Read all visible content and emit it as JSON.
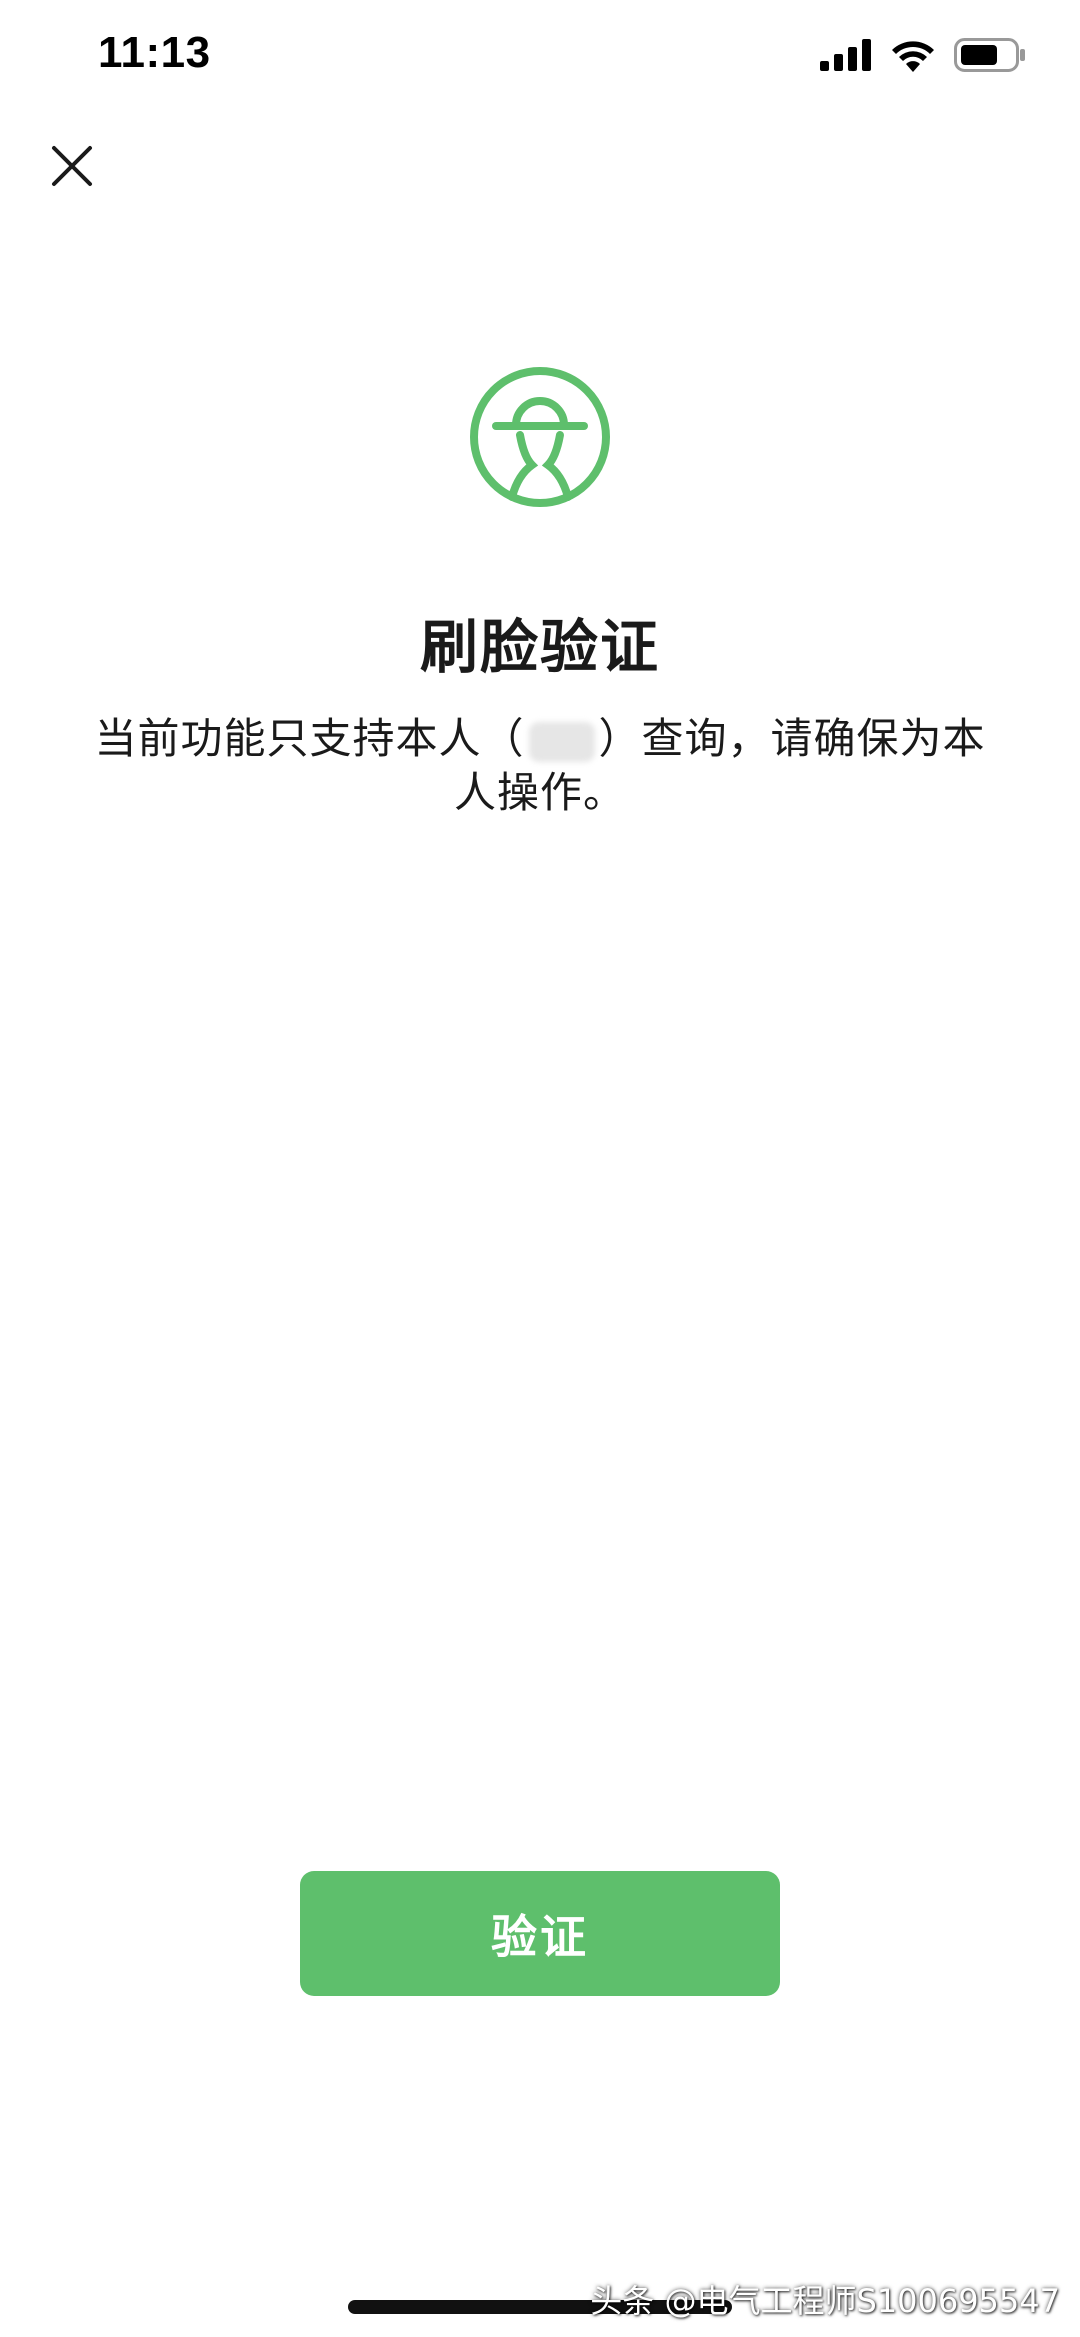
{
  "status_bar": {
    "time": "11:13",
    "icons": [
      "signal-icon",
      "wifi-icon",
      "battery-icon"
    ]
  },
  "header": {
    "close_icon": "close-icon"
  },
  "logo": {
    "icon": "face-verify-icon",
    "color": "#5ebf6c"
  },
  "main": {
    "title": "刷脸验证",
    "description_before": "当前功能只支持本人（",
    "description_after": "）查询，请确保为本人操作。"
  },
  "actions": {
    "verify_label": "验证",
    "verify_color": "#5ebf6c"
  },
  "watermark": {
    "text": "头条 @电气工程师S100695547"
  }
}
